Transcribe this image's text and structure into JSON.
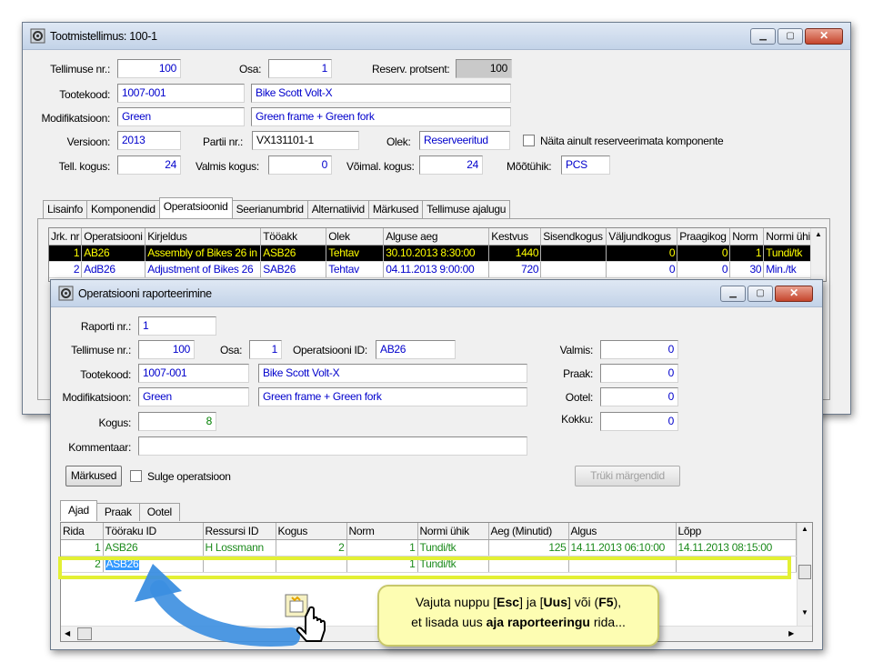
{
  "main_window": {
    "title": "Tootmistellimus: 100-1",
    "fields": {
      "order_no_label": "Tellimuse nr.:",
      "order_no": "100",
      "part_label": "Osa:",
      "part": "1",
      "reserve_pct_label": "Reserv. protsent:",
      "reserve_pct": "100",
      "product_code_label": "Tootekood:",
      "product_code": "1007-001",
      "product_name": "Bike Scott Volt-X",
      "modification_label": "Modifikatsioon:",
      "modification": "Green",
      "modification_desc": "Green frame + Green fork",
      "version_label": "Versioon:",
      "version": "2013",
      "batch_label": "Partii nr.:",
      "batch": "VX131101-1",
      "status_label": "Olek:",
      "status": "Reserveeritud",
      "show_unreserved_label": "Näita ainult reserveerimata komponente",
      "ordered_qty_label": "Tell. kogus:",
      "ordered_qty": "24",
      "done_qty_label": "Valmis kogus:",
      "done_qty": "0",
      "possible_qty_label": "Võimal. kogus:",
      "possible_qty": "24",
      "unit_label": "Mõõtühik:",
      "unit": "PCS"
    },
    "tabs": [
      "Lisainfo",
      "Komponendid",
      "Operatsioonid",
      "Seerianumbrid",
      "Alternatiivid",
      "Märkused",
      "Tellimuse ajalugu"
    ],
    "active_tab": "Operatsioonid",
    "ops_columns": [
      "Jrk. nr",
      "Operatsiooni",
      "Kirjeldus",
      "Tööakk",
      "Olek",
      "Alguse aeg",
      "Kestvus",
      "Sisendkogus",
      "Väljundkogus",
      "Praagikog",
      "Norm",
      "Normi ühik"
    ],
    "ops_rows": [
      [
        "1",
        "AB26",
        "Assembly of Bikes 26 in",
        "ASB26",
        "Tehtav",
        "30.10.2013 8:30:00",
        "1440",
        "",
        "0",
        "0",
        "1",
        "Tundi/tk"
      ],
      [
        "2",
        "AdB26",
        "Adjustment of Bikes 26",
        "SAB26",
        "Tehtav",
        "04.11.2013 9:00:00",
        "720",
        "",
        "0",
        "0",
        "30",
        "Min./tk"
      ]
    ]
  },
  "report_window": {
    "title": "Operatsiooni raporteerimine",
    "fields": {
      "report_no_label": "Raporti nr.:",
      "report_no": "1",
      "order_no_label": "Tellimuse nr.:",
      "order_no": "100",
      "part_label": "Osa:",
      "part": "1",
      "op_id_label": "Operatsiooni ID:",
      "op_id": "AB26",
      "product_code_label": "Tootekood:",
      "product_code": "1007-001",
      "product_name": "Bike Scott Volt-X",
      "modification_label": "Modifikatsioon:",
      "modification": "Green",
      "modification_desc": "Green frame + Green fork",
      "qty_label": "Kogus:",
      "qty": "8",
      "comment_label": "Kommentaar:",
      "comment": "",
      "done_label": "Valmis:",
      "done": "0",
      "scrap_label": "Praak:",
      "scrap": "0",
      "wait_label": "Ootel:",
      "wait": "0",
      "total_label": "Kokku:",
      "total": "0"
    },
    "notes_button": "Märkused",
    "close_op_label": "Sulge operatsioon",
    "print_labels_button": "Trüki märgendid",
    "tabs": [
      "Ajad",
      "Praak",
      "Ootel"
    ],
    "active_tab": "Ajad",
    "columns": [
      "Rida",
      "Tööraku ID",
      "Ressursi ID",
      "Kogus",
      "Norm",
      "Normi ühik",
      "Aeg (Minutid)",
      "Algus",
      "Lõpp"
    ],
    "rows": [
      [
        "1",
        "ASB26",
        "H Lossmann",
        "2",
        "1",
        "Tundi/tk",
        "125",
        "14.11.2013 06:10:00",
        "14.11.2013 08:15:00"
      ],
      [
        "2",
        "ASB26",
        "",
        "",
        "1",
        "Tundi/tk",
        "",
        "",
        ""
      ]
    ]
  },
  "callout": {
    "line1_a": "Vajuta nuppu [",
    "key_esc": "Esc",
    "line1_b": "] ja [",
    "key_new": "Uus",
    "line1_c": "] või (",
    "key_f5": "F5",
    "line1_d": "),",
    "line2_a": "et lisada uus ",
    "line2_bold": "aja raporteeringu",
    "line2_b": " rida..."
  },
  "colors": {
    "highlight": "#e3f034",
    "callout_bg": "#fdfdb2",
    "arrow": "#3b8ee0",
    "selected_row": "#000000",
    "selected_text": "#ffff00"
  }
}
